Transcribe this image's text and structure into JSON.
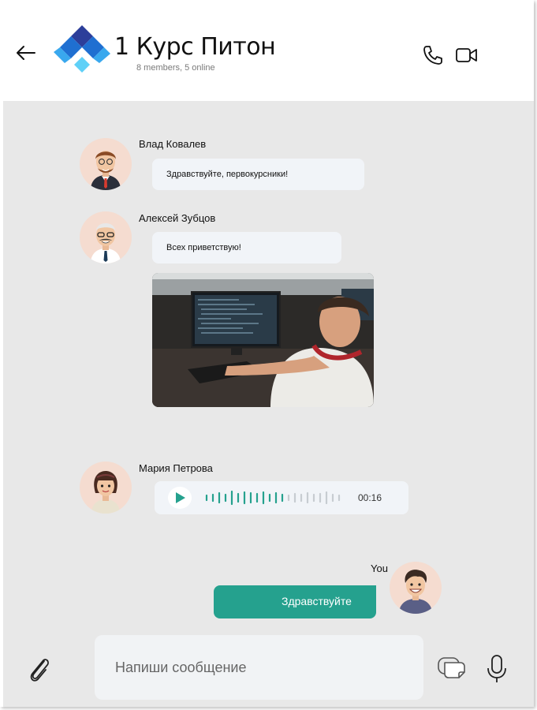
{
  "header": {
    "title": "1 Курс Питон",
    "subtitle": "8 members, 5 online"
  },
  "messages": [
    {
      "sender": "Влад Ковалев",
      "text": "Здравствуйте, первокурсники!"
    },
    {
      "sender": "Алексей Зубцов",
      "text": "Всех приветствую!"
    },
    {
      "sender": "Мария Петрова",
      "voice_duration": "00:16",
      "voice_progress": 0.45
    },
    {
      "sender": "You",
      "text": "Здравствуйте"
    }
  ],
  "composer": {
    "placeholder": "Напиши сообщение"
  },
  "colors": {
    "accent": "#25a18e",
    "chat_bg": "#e8e8e8",
    "bubble_bg": "#f1f4f8",
    "logo_dark": "#1e3a8a",
    "logo_light": "#4cc9f0"
  },
  "icons": [
    "back-arrow-icon",
    "group-logo-icon",
    "phone-icon",
    "video-camera-icon",
    "play-icon",
    "paperclip-icon",
    "sticker-icon",
    "microphone-icon"
  ]
}
